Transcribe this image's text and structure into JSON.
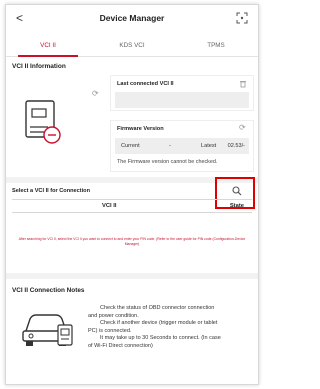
{
  "header": {
    "title": "Device Manager",
    "back": "<"
  },
  "tabs": [
    {
      "label": "VCI II",
      "active": true
    },
    {
      "label": "KDS VCI",
      "active": false
    },
    {
      "label": "TPMS",
      "active": false
    }
  ],
  "vci_info": {
    "title": "VCI II Information",
    "last_connected": {
      "title": "Last connected VCI II",
      "value": ""
    },
    "firmware": {
      "title": "Firmware Version",
      "current_label": "Current",
      "current_value": "-",
      "latest_label": "Latest",
      "latest_value": "02.53/-",
      "note": "The Firmware version cannot be checked."
    }
  },
  "connection": {
    "title": "Select a VCI II for Connection",
    "columns": [
      "VCI II",
      "State"
    ],
    "notice": "After searching for VCI II, select the VCI II you want to connect to and enter your PIN code. (Refer to the user guide for PIN code.(Configuration-Device Manager)"
  },
  "notes": {
    "title": "VCI II Connection Notes",
    "lines": [
      "Check the status of OBD connector connection",
      "and power condition.",
      "Check if another device (trigger module or tablet",
      "PC) is connected.",
      "It may take up to 30 Seconds to connect. (In case",
      "of Wi-Fi Direct connection)"
    ]
  },
  "colors": {
    "accent": "#c8102e",
    "highlight": "#e00000"
  },
  "icons": {
    "back": "chevron-left-icon",
    "scan": "scan-qr-icon",
    "refresh": "refresh-icon",
    "delete": "trash-icon",
    "search": "search-icon",
    "device": "vci-device-icon",
    "car": "car-icon"
  }
}
